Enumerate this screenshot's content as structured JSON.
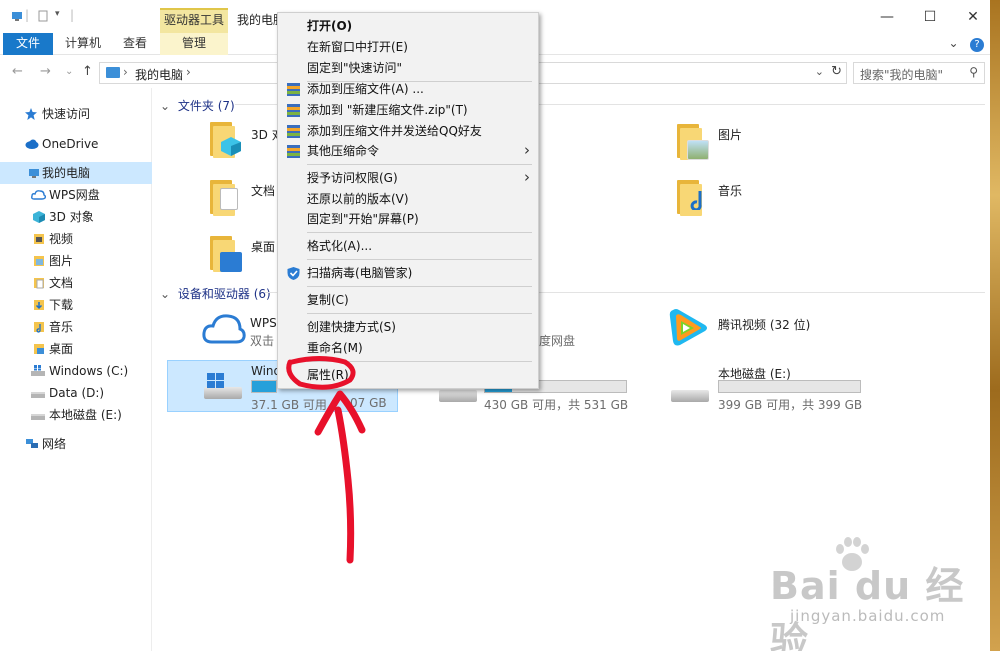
{
  "window": {
    "title": "我的电脑",
    "contextual_tab_group": "驱动器工具"
  },
  "ribbon": {
    "tabs": [
      "文件",
      "计算机",
      "查看",
      "管理"
    ],
    "help": "?"
  },
  "address": {
    "path": "我的电脑",
    "search_placeholder": "搜索\"我的电脑\""
  },
  "sidebar": {
    "items": [
      {
        "label": "快速访问",
        "icon": "star-icon"
      },
      {
        "label": "OneDrive",
        "icon": "cloud-icon"
      },
      {
        "label": "我的电脑",
        "icon": "computer-icon"
      },
      {
        "label": "WPS网盘",
        "icon": "wps-cloud-icon"
      },
      {
        "label": "3D 对象",
        "icon": "cube-icon"
      },
      {
        "label": "视频",
        "icon": "video-icon"
      },
      {
        "label": "图片",
        "icon": "picture-icon"
      },
      {
        "label": "文档",
        "icon": "document-icon"
      },
      {
        "label": "下载",
        "icon": "download-icon"
      },
      {
        "label": "音乐",
        "icon": "music-icon"
      },
      {
        "label": "桌面",
        "icon": "desktop-icon"
      },
      {
        "label": "Windows (C:)",
        "icon": "drive-c-icon"
      },
      {
        "label": "Data (D:)",
        "icon": "drive-icon"
      },
      {
        "label": "本地磁盘 (E:)",
        "icon": "drive-icon"
      },
      {
        "label": "网络",
        "icon": "network-icon"
      }
    ]
  },
  "main": {
    "folders_header": "文件夹 (7)",
    "folders": [
      {
        "label": "3D 对"
      },
      {
        "label": "文档"
      },
      {
        "label": "桌面"
      },
      {
        "label": "图片"
      },
      {
        "label": "音乐"
      }
    ],
    "devices_header": "设备和驱动器 (6)",
    "devices": {
      "wps": {
        "label": "WPS",
        "sub": "双击"
      },
      "baidu_sub": "度网盘",
      "tencent": {
        "label": "腾讯视频 (32 位)"
      },
      "windows_c": {
        "label": "Wind",
        "space": "37.1 GB 可用，",
        "space_tail": "07 GB",
        "used_fraction": 0.75
      },
      "data_d": {
        "space": "430 GB 可用，共 531 GB",
        "used_fraction": 0.19
      },
      "local_e": {
        "label": "本地磁盘 (E:)",
        "space": "399 GB 可用，共 399 GB",
        "used_fraction": 0.0
      }
    }
  },
  "context_menu": {
    "items": [
      "打开(O)",
      "在新窗口中打开(E)",
      "固定到\"快速访问\"",
      "添加到压缩文件(A) ...",
      "添加到 \"新建压缩文件.zip\"(T)",
      "添加到压缩文件并发送给QQ好友",
      "其他压缩命令",
      "授予访问权限(G)",
      "还原以前的版本(V)",
      "固定到\"开始\"屏幕(P)",
      "格式化(A)...",
      "扫描病毒(电脑管家)",
      "复制(C)",
      "创建快捷方式(S)",
      "重命名(M)",
      "属性(R)"
    ]
  },
  "watermark": {
    "logo": "Bai du 经验",
    "url": "jingyan.baidu.com"
  },
  "colors": {
    "accent": "#1979ca",
    "selection": "#cce8ff",
    "progress": "#26a0da",
    "annotation": "#e8112b",
    "manage_tab": "#f3e6a0"
  }
}
